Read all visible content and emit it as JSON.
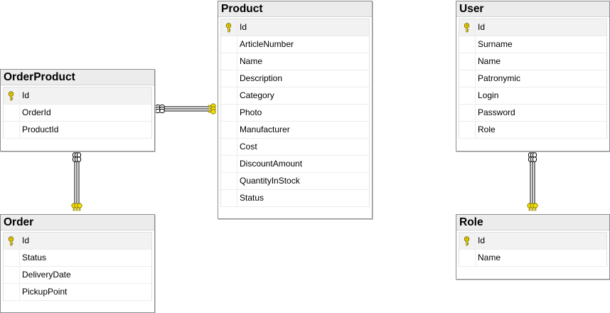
{
  "tables": [
    {
      "id": "product",
      "name": "Product",
      "columns": [
        {
          "name": "Id",
          "pk": true
        },
        {
          "name": "ArticleNumber",
          "pk": false
        },
        {
          "name": "Name",
          "pk": false
        },
        {
          "name": "Description",
          "pk": false
        },
        {
          "name": "Category",
          "pk": false
        },
        {
          "name": "Photo",
          "pk": false
        },
        {
          "name": "Manufacturer",
          "pk": false
        },
        {
          "name": "Cost",
          "pk": false
        },
        {
          "name": "DiscountAmount",
          "pk": false
        },
        {
          "name": "QuantityInStock",
          "pk": false
        },
        {
          "name": "Status",
          "pk": false
        }
      ]
    },
    {
      "id": "user",
      "name": "User",
      "columns": [
        {
          "name": "Id",
          "pk": true
        },
        {
          "name": "Surname",
          "pk": false
        },
        {
          "name": "Name",
          "pk": false
        },
        {
          "name": "Patronymic",
          "pk": false
        },
        {
          "name": "Login",
          "pk": false
        },
        {
          "name": "Password",
          "pk": false
        },
        {
          "name": "Role",
          "pk": false
        }
      ]
    },
    {
      "id": "orderproduct",
      "name": "OrderProduct",
      "columns": [
        {
          "name": "Id",
          "pk": true
        },
        {
          "name": "OrderId",
          "pk": false
        },
        {
          "name": "ProductId",
          "pk": false
        }
      ]
    },
    {
      "id": "order",
      "name": "Order",
      "columns": [
        {
          "name": "Id",
          "pk": true
        },
        {
          "name": "Status",
          "pk": false
        },
        {
          "name": "DeliveryDate",
          "pk": false
        },
        {
          "name": "PickupPoint",
          "pk": false
        }
      ]
    },
    {
      "id": "role",
      "name": "Role",
      "columns": [
        {
          "name": "Id",
          "pk": true
        },
        {
          "name": "Name",
          "pk": false
        }
      ]
    }
  ],
  "relationships": [
    {
      "from": "orderproduct",
      "to": "product",
      "one_end": "product",
      "many_end": "orderproduct"
    },
    {
      "from": "orderproduct",
      "to": "order",
      "one_end": "order",
      "many_end": "orderproduct"
    },
    {
      "from": "user",
      "to": "role",
      "one_end": "role",
      "many_end": "user"
    }
  ],
  "colors": {
    "key": "#f5e000",
    "key_outline": "#7a6a00",
    "line": "#000000"
  },
  "icons": {
    "primary_key": "key-icon",
    "many_end": "infinity-icon",
    "one_end": "key-icon"
  }
}
